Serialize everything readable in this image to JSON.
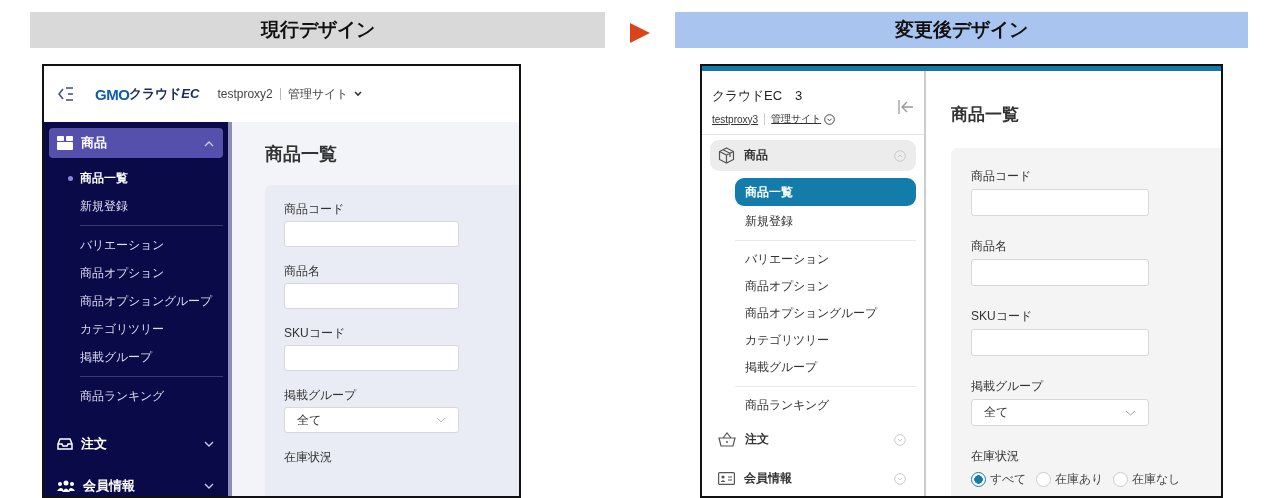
{
  "panels": [
    {
      "kind": "current",
      "heading": "現行デザイン",
      "logo_mark": "GMO",
      "logo_text": "クラウド",
      "logo_suffix": "EC",
      "account": "testproxy2",
      "site": "管理サイト",
      "nav": [
        {
          "label": "商品",
          "expanded": true,
          "groups": [
            [
              {
                "label": "商品一覧",
                "selected": true
              },
              {
                "label": "新規登録",
                "selected": false
              }
            ],
            [
              {
                "label": "バリエーション",
                "selected": false
              },
              {
                "label": "商品オプション",
                "selected": false
              },
              {
                "label": "商品オプショングループ",
                "selected": false
              },
              {
                "label": "カテゴリツリー",
                "selected": false
              },
              {
                "label": "掲載グループ",
                "selected": false
              }
            ],
            [
              {
                "label": "商品ランキング",
                "selected": false
              }
            ]
          ]
        },
        {
          "label": "注文",
          "expanded": false
        },
        {
          "label": "会員情報",
          "expanded": false
        }
      ],
      "page_title": "商品一覧",
      "fields": [
        {
          "kind": "text",
          "label": "商品コード"
        },
        {
          "kind": "text",
          "label": "商品名"
        },
        {
          "kind": "text",
          "label": "SKUコード"
        },
        {
          "kind": "select",
          "label": "掲載グループ",
          "value": "全て"
        },
        {
          "kind": "radio",
          "label": "在庫状況"
        }
      ]
    },
    {
      "kind": "new",
      "heading": "変更後デザイン",
      "title": "クラウドEC　3",
      "account": "testproxy3",
      "site": "管理サイト",
      "nav": [
        {
          "label": "商品",
          "expanded": true,
          "groups": [
            [
              {
                "label": "商品一覧",
                "selected": true
              },
              {
                "label": "新規登録",
                "selected": false
              }
            ],
            [
              {
                "label": "バリエーション",
                "selected": false
              },
              {
                "label": "商品オプション",
                "selected": false
              },
              {
                "label": "商品オプショングループ",
                "selected": false
              },
              {
                "label": "カテゴリツリー",
                "selected": false
              },
              {
                "label": "掲載グループ",
                "selected": false
              }
            ],
            [
              {
                "label": "商品ランキング",
                "selected": false
              }
            ]
          ]
        },
        {
          "label": "注文",
          "expanded": false
        },
        {
          "label": "会員情報",
          "expanded": false
        }
      ],
      "page_title": "商品一覧",
      "fields": [
        {
          "kind": "text",
          "label": "商品コード"
        },
        {
          "kind": "text",
          "label": "商品名"
        },
        {
          "kind": "text",
          "label": "SKUコード"
        },
        {
          "kind": "select",
          "label": "掲載グループ",
          "value": "全て"
        },
        {
          "kind": "radio",
          "label": "在庫状況",
          "options": [
            {
              "label": "すべて",
              "selected": true
            },
            {
              "label": "在庫あり",
              "selected": false
            },
            {
              "label": "在庫なし",
              "selected": false
            }
          ]
        }
      ]
    }
  ]
}
